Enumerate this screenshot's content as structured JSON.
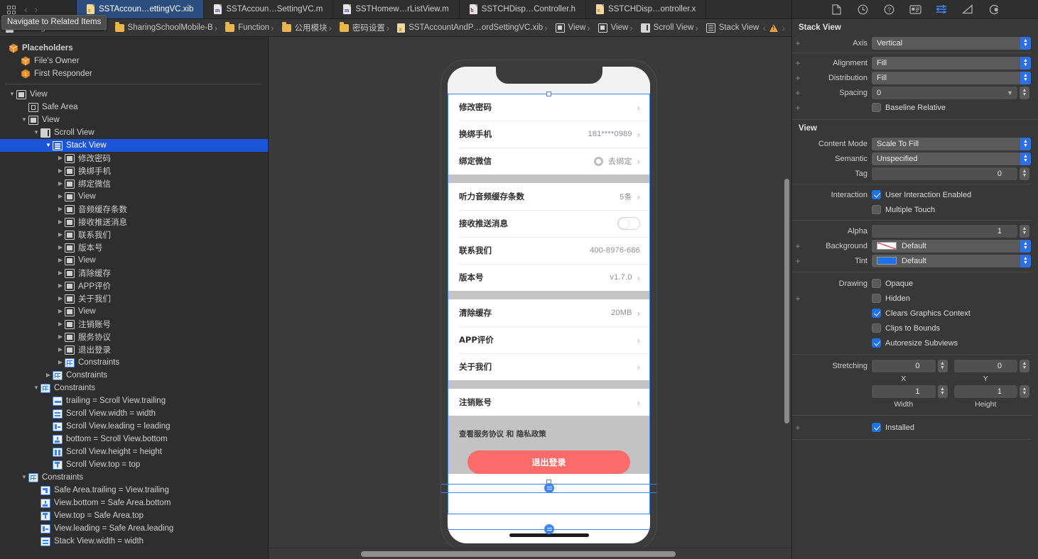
{
  "tabbar": {
    "nav_tooltip": "Navigate to Related Items",
    "tabs": [
      {
        "label": "SSTAccoun…ettingVC.xib",
        "kind": "xib",
        "letter": "x",
        "active": true
      },
      {
        "label": "SSTAccoun…SettingVC.m",
        "kind": "m",
        "letter": "m",
        "active": false
      },
      {
        "label": "SSTHomew…rListView.m",
        "kind": "m",
        "letter": "m",
        "active": false
      },
      {
        "label": "SSTCHDisp…Controller.h",
        "kind": "h",
        "letter": "h",
        "active": false
      },
      {
        "label": "SSTCHDisp…ontroller.x",
        "kind": "xib",
        "letter": "x",
        "active": false
      }
    ]
  },
  "jumpbar": {
    "crumbs": [
      {
        "label": "SharingSchoolMobile-B",
        "icon": "project-icon"
      },
      {
        "label": "SharingSchoolMobile-B",
        "icon": "folder-icon"
      },
      {
        "label": "Function",
        "icon": "folder-icon"
      },
      {
        "label": "公用模块",
        "icon": "folder-icon"
      },
      {
        "label": "密码设置",
        "icon": "folder-icon"
      },
      {
        "label": "SSTAccountAndP…ordSettingVC.xib",
        "icon": "xib-icon"
      },
      {
        "label": "View",
        "icon": "view-icon"
      },
      {
        "label": "View",
        "icon": "view-icon"
      },
      {
        "label": "Scroll View",
        "icon": "scrollview-icon"
      },
      {
        "label": "Stack View",
        "icon": "stackview-icon"
      }
    ],
    "warning_count": "1"
  },
  "outline": {
    "placeholders_label": "Placeholders",
    "placeholders": [
      "File's Owner",
      "First Responder"
    ],
    "items": [
      {
        "label": "View",
        "indent": 0,
        "disc": "down",
        "icon": "view-icon"
      },
      {
        "label": "Safe Area",
        "indent": 1,
        "disc": "none",
        "icon": "safearea-icon"
      },
      {
        "label": "View",
        "indent": 1,
        "disc": "down",
        "icon": "view-icon"
      },
      {
        "label": "Scroll View",
        "indent": 2,
        "disc": "down",
        "icon": "scrollview-icon"
      },
      {
        "label": "Stack View",
        "indent": 3,
        "disc": "down",
        "icon": "stackview-icon",
        "selected": true
      },
      {
        "label": "修改密码",
        "indent": 4,
        "disc": "right",
        "icon": "view-icon"
      },
      {
        "label": "换绑手机",
        "indent": 4,
        "disc": "right",
        "icon": "view-icon"
      },
      {
        "label": "绑定微信",
        "indent": 4,
        "disc": "right",
        "icon": "view-icon"
      },
      {
        "label": "View",
        "indent": 4,
        "disc": "right",
        "icon": "view-icon"
      },
      {
        "label": "音频缓存条数",
        "indent": 4,
        "disc": "right",
        "icon": "view-icon"
      },
      {
        "label": "接收推送消息",
        "indent": 4,
        "disc": "right",
        "icon": "view-icon"
      },
      {
        "label": "联系我们",
        "indent": 4,
        "disc": "right",
        "icon": "view-icon"
      },
      {
        "label": "版本号",
        "indent": 4,
        "disc": "right",
        "icon": "view-icon"
      },
      {
        "label": "View",
        "indent": 4,
        "disc": "right",
        "icon": "view-icon"
      },
      {
        "label": "清除缓存",
        "indent": 4,
        "disc": "right",
        "icon": "view-icon"
      },
      {
        "label": "APP评价",
        "indent": 4,
        "disc": "right",
        "icon": "view-icon"
      },
      {
        "label": "关于我们",
        "indent": 4,
        "disc": "right",
        "icon": "view-icon"
      },
      {
        "label": "View",
        "indent": 4,
        "disc": "right",
        "icon": "view-icon"
      },
      {
        "label": "注销账号",
        "indent": 4,
        "disc": "right",
        "icon": "view-icon"
      },
      {
        "label": "服务协议",
        "indent": 4,
        "disc": "right",
        "icon": "view-icon"
      },
      {
        "label": "退出登录",
        "indent": 4,
        "disc": "right",
        "icon": "view-icon"
      },
      {
        "label": "Constraints",
        "indent": 4,
        "disc": "right",
        "icon": "constraints-icon"
      },
      {
        "label": "Constraints",
        "indent": 3,
        "disc": "right",
        "icon": "constraints-icon"
      },
      {
        "label": "Constraints",
        "indent": 2,
        "disc": "down",
        "icon": "constraints-icon"
      },
      {
        "label": "trailing = Scroll View.trailing",
        "indent": 3,
        "disc": "none",
        "icon": "constraint-h-icon"
      },
      {
        "label": "Scroll View.width = width",
        "indent": 3,
        "disc": "none",
        "icon": "constraint-w-icon"
      },
      {
        "label": "Scroll View.leading = leading",
        "indent": 3,
        "disc": "none",
        "icon": "constraint-l-icon"
      },
      {
        "label": "bottom = Scroll View.bottom",
        "indent": 3,
        "disc": "none",
        "icon": "constraint-b-icon"
      },
      {
        "label": "Scroll View.height = height",
        "indent": 3,
        "disc": "none",
        "icon": "constraint-hh-icon"
      },
      {
        "label": "Scroll View.top = top",
        "indent": 3,
        "disc": "none",
        "icon": "constraint-t-icon"
      },
      {
        "label": "Constraints",
        "indent": 1,
        "disc": "down",
        "icon": "constraints-icon"
      },
      {
        "label": "Safe Area.trailing = View.trailing",
        "indent": 2,
        "disc": "none",
        "icon": "constraint-tr-icon"
      },
      {
        "label": "View.bottom = Safe Area.bottom",
        "indent": 2,
        "disc": "none",
        "icon": "constraint-b-icon"
      },
      {
        "label": "View.top = Safe Area.top",
        "indent": 2,
        "disc": "none",
        "icon": "constraint-t-icon"
      },
      {
        "label": "View.leading = Safe Area.leading",
        "indent": 2,
        "disc": "none",
        "icon": "constraint-l-icon"
      },
      {
        "label": "Stack View.width = width",
        "indent": 2,
        "disc": "none",
        "icon": "constraint-w-icon"
      }
    ]
  },
  "canvas": {
    "sections": [
      {
        "rows": [
          {
            "label": "修改密码",
            "value": "",
            "arrow": true,
            "control": "none"
          },
          {
            "label": "换绑手机",
            "value": "181****0989",
            "arrow": true,
            "control": "none"
          },
          {
            "label": "绑定微信",
            "value": "去绑定",
            "arrow": true,
            "control": "wechat-circle"
          }
        ]
      },
      {
        "rows": [
          {
            "label": "听力音频缓存条数",
            "value": "5条",
            "arrow": true,
            "control": "none"
          },
          {
            "label": "接收推送消息",
            "value": "",
            "arrow": false,
            "control": "switch"
          },
          {
            "label": "联系我们",
            "value": "400-8976-686",
            "arrow": false,
            "control": "none"
          },
          {
            "label": "版本号",
            "value": "v1.7.0",
            "arrow": true,
            "control": "none"
          }
        ]
      },
      {
        "rows": [
          {
            "label": "清除缓存",
            "value": "20MB",
            "arrow": true,
            "control": "none"
          },
          {
            "label": "APP评价",
            "value": "",
            "arrow": true,
            "control": "none"
          },
          {
            "label": "关于我们",
            "value": "",
            "arrow": true,
            "control": "none"
          }
        ]
      },
      {
        "rows": [
          {
            "label": "注销账号",
            "value": "",
            "arrow": true,
            "control": "none"
          }
        ]
      }
    ],
    "footer_terms": "查看服务协议 和 隐私政策",
    "logout_label": "退出登录",
    "logout_color": "#fa6b69"
  },
  "inspector": {
    "tabs": [
      {
        "name": "file-inspector",
        "active": false
      },
      {
        "name": "history-inspector",
        "active": false
      },
      {
        "name": "quick-help-inspector",
        "active": false
      },
      {
        "name": "identity-inspector",
        "active": false
      },
      {
        "name": "attributes-inspector",
        "active": true
      },
      {
        "name": "size-inspector",
        "active": false
      },
      {
        "name": "connections-inspector",
        "active": false
      }
    ],
    "accent": "#3f86f5",
    "stackview": {
      "title": "Stack View",
      "axis_label": "Axis",
      "axis_value": "Vertical",
      "alignment_label": "Alignment",
      "alignment_value": "Fill",
      "distribution_label": "Distribution",
      "distribution_value": "Fill",
      "spacing_label": "Spacing",
      "spacing_value": "0",
      "baseline_label": "Baseline Relative",
      "baseline_checked": false
    },
    "view": {
      "title": "View",
      "content_mode_label": "Content Mode",
      "content_mode_value": "Scale To Fill",
      "semantic_label": "Semantic",
      "semantic_value": "Unspecified",
      "tag_label": "Tag",
      "tag_value": "0",
      "interaction_label": "Interaction",
      "user_interaction_label": "User Interaction Enabled",
      "user_interaction_checked": true,
      "multiple_touch_label": "Multiple Touch",
      "multiple_touch_checked": false,
      "alpha_label": "Alpha",
      "alpha_value": "1",
      "background_label": "Background",
      "background_value": "Default",
      "tint_label": "Tint",
      "tint_value": "Default",
      "tint_color": "#1b72ec",
      "drawing_label": "Drawing",
      "opaque_label": "Opaque",
      "opaque_checked": false,
      "hidden_label": "Hidden",
      "hidden_checked": false,
      "clears_label": "Clears Graphics Context",
      "clears_checked": true,
      "clips_label": "Clips to Bounds",
      "clips_checked": false,
      "autoresize_label": "Autoresize Subviews",
      "autoresize_checked": true,
      "stretching_label": "Stretching",
      "stretch_x": "0",
      "stretch_y": "0",
      "stretch_w": "1",
      "stretch_h": "1",
      "x_label": "X",
      "y_label": "Y",
      "width_label": "Width",
      "height_label": "Height",
      "installed_label": "Installed",
      "installed_checked": true
    }
  }
}
